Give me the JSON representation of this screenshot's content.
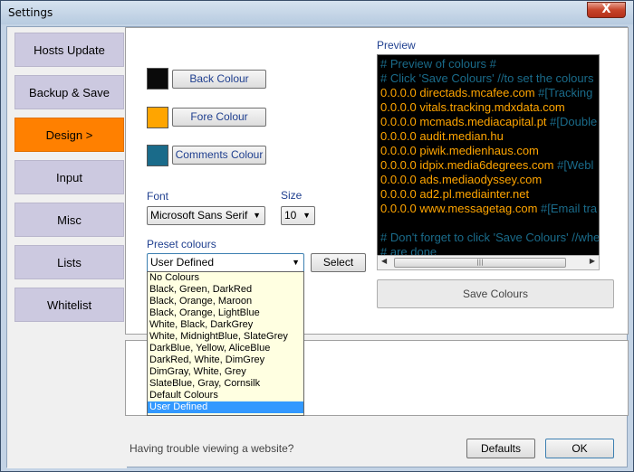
{
  "window": {
    "title": "Settings",
    "close_symbol": "X"
  },
  "sidebar": {
    "items": [
      {
        "label": "Hosts Update"
      },
      {
        "label": "Backup & Save"
      },
      {
        "label": "Design  >"
      },
      {
        "label": "Input"
      },
      {
        "label": "Misc"
      },
      {
        "label": "Lists"
      },
      {
        "label": "Whitelist"
      }
    ],
    "active_index": 2
  },
  "design": {
    "back_colour_label": "Back Colour",
    "back_colour": "#0a0a0a",
    "fore_colour_label": "Fore Colour",
    "fore_colour": "#ffa500",
    "comments_colour_label": "Comments Colour",
    "comments_colour": "#1a6b8a",
    "font_label": "Font",
    "font_value": "Microsoft Sans Serif",
    "size_label": "Size",
    "size_value": "10",
    "preset_label": "Preset colours",
    "preset_value": "User Defined",
    "select_label": "Select",
    "preset_options": [
      "No Colours",
      "Black, Green, DarkRed",
      "Black, Orange, Maroon",
      "Black, Orange, LightBlue",
      "White, Black, DarkGrey",
      "White, MidnightBlue, SlateGrey",
      "DarkBlue, Yellow, AliceBlue",
      "DarkRed, White, DimGrey",
      "DimGray, White, Grey",
      "SlateBlue, Gray, Cornsilk",
      "Default Colours",
      "User Defined"
    ]
  },
  "preview": {
    "label": "Preview",
    "lines": [
      {
        "host": "",
        "text": "# Preview of colours #",
        "comment": true
      },
      {
        "host": "",
        "text": "# Click 'Save Colours' //to set the colours",
        "comment": true
      },
      {
        "host": "0.0.0.0 directads.mcafee.com",
        "text": " #[Tracking",
        "comment": false
      },
      {
        "host": "0.0.0.0 vitals.tracking.mdxdata.com",
        "text": "",
        "comment": false
      },
      {
        "host": "0.0.0.0 mcmads.mediacapital.pt",
        "text": " #[Double",
        "comment": false
      },
      {
        "host": "0.0.0.0 audit.median.hu",
        "text": "",
        "comment": false
      },
      {
        "host": "0.0.0.0 piwik.medienhaus.com",
        "text": "",
        "comment": false
      },
      {
        "host": "0.0.0.0 idpix.media6degrees.com",
        "text": " #[Webl",
        "comment": false
      },
      {
        "host": "0.0.0.0 ads.mediaodyssey.com",
        "text": "",
        "comment": false
      },
      {
        "host": "0.0.0.0 ad2.pl.mediainter.net",
        "text": "",
        "comment": false
      },
      {
        "host": "0.0.0.0 www.messagetag.com",
        "text": " #[Email tra",
        "comment": false
      },
      {
        "host": "",
        "text": "",
        "comment": true
      },
      {
        "host": "",
        "text": "# Don't forget to click 'Save Colours' //whe",
        "comment": true
      },
      {
        "host": "",
        "text": "# are done",
        "comment": true
      }
    ],
    "save_label": "Save Colours"
  },
  "footer": {
    "trouble_text": "Having trouble viewing a website?",
    "defaults_label": "Defaults",
    "ok_label": "OK"
  }
}
